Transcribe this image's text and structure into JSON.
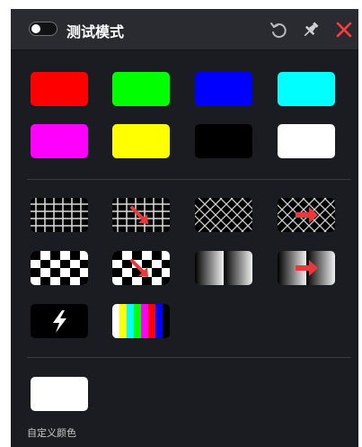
{
  "header": {
    "title": "测试模式",
    "toggle_state": "off",
    "icons": [
      "undo-icon",
      "pin-icon",
      "close-icon"
    ]
  },
  "solid_colors": [
    {
      "name": "red",
      "color": "#ff0000"
    },
    {
      "name": "green",
      "color": "#00ff00"
    },
    {
      "name": "blue",
      "color": "#0000ff"
    },
    {
      "name": "cyan",
      "color": "#00ffff"
    },
    {
      "name": "magenta",
      "color": "#ff00ff"
    },
    {
      "name": "yellow",
      "color": "#ffff00"
    },
    {
      "name": "black",
      "color": "#000000"
    },
    {
      "name": "white",
      "color": "#ffffff"
    }
  ],
  "patterns": [
    {
      "name": "grid"
    },
    {
      "name": "grid-moving"
    },
    {
      "name": "crosshatch"
    },
    {
      "name": "crosshatch-moving"
    },
    {
      "name": "checkerboard"
    },
    {
      "name": "checkerboard-moving"
    },
    {
      "name": "gradient"
    },
    {
      "name": "gradient-moving"
    },
    {
      "name": "flash"
    },
    {
      "name": "color-bars"
    }
  ],
  "colors": {
    "accent_red": "#e83a3a",
    "close_red": "#ff3b3b",
    "panel_bg": "#1b1c21",
    "header_bg": "#2a2b30"
  },
  "custom": {
    "label": "自定义颜色",
    "color": "#ffffff"
  }
}
